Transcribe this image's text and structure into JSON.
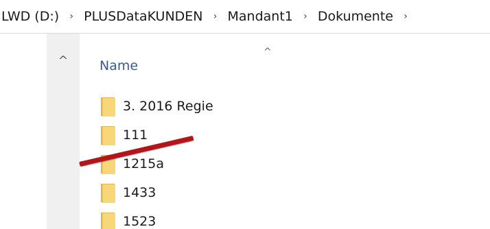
{
  "breadcrumb": {
    "items": [
      {
        "label": "LWD (D:)"
      },
      {
        "label": "PLUSDataKUNDEN"
      },
      {
        "label": "Mandant1"
      },
      {
        "label": "Dokumente"
      }
    ],
    "separator": "›"
  },
  "nav": {
    "scroll_up_icon": "^"
  },
  "column": {
    "name_label": "Name",
    "sort_indicator": "^"
  },
  "files": [
    {
      "name": "3.  2016 Regie",
      "icon": "folder-icon"
    },
    {
      "name": "111",
      "icon": "folder-icon"
    },
    {
      "name": "1215a",
      "icon": "folder-icon"
    },
    {
      "name": "1433",
      "icon": "folder-icon"
    },
    {
      "name": "1523",
      "icon": "folder-icon"
    }
  ],
  "colors": {
    "folder_front": "#f8d77a",
    "folder_back": "#e3b54f",
    "strike": "#b3151a",
    "column_header": "#3c5a8a"
  }
}
